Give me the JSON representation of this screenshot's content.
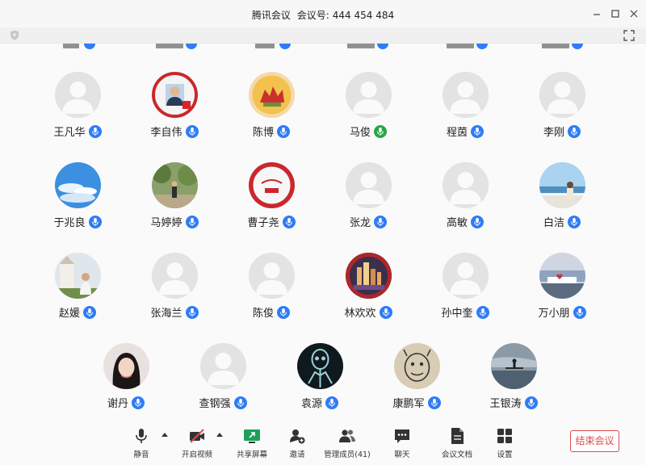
{
  "window": {
    "app_name": "腾讯会议",
    "meeting_id_label": "会议号:",
    "meeting_id": "444 454 484"
  },
  "participants": [
    {
      "name": "王凡华",
      "avatar": "default",
      "mic": "unmuted"
    },
    {
      "name": "李自伟",
      "avatar": "photo-man-red-badge",
      "mic": "unmuted"
    },
    {
      "name": "陈博",
      "avatar": "castle-emblem",
      "mic": "unmuted"
    },
    {
      "name": "马俊",
      "avatar": "default",
      "mic": "speaking"
    },
    {
      "name": "程茵",
      "avatar": "default",
      "mic": "unmuted"
    },
    {
      "name": "李刚",
      "avatar": "default",
      "mic": "unmuted"
    },
    {
      "name": "于兆良",
      "avatar": "blue-sky",
      "mic": "unmuted"
    },
    {
      "name": "马婷婷",
      "avatar": "garden-person",
      "mic": "unmuted"
    },
    {
      "name": "曹子尧",
      "avatar": "university-seal",
      "mic": "unmuted"
    },
    {
      "name": "张龙",
      "avatar": "default",
      "mic": "unmuted"
    },
    {
      "name": "高敏",
      "avatar": "default",
      "mic": "unmuted"
    },
    {
      "name": "白洁",
      "avatar": "seaside-woman",
      "mic": "unmuted"
    },
    {
      "name": "赵媛",
      "avatar": "church-woman",
      "mic": "unmuted"
    },
    {
      "name": "张海兰",
      "avatar": "default",
      "mic": "unmuted"
    },
    {
      "name": "陈俊",
      "avatar": "default",
      "mic": "unmuted"
    },
    {
      "name": "林欢欢",
      "avatar": "city-night",
      "mic": "unmuted"
    },
    {
      "name": "孙中奎",
      "avatar": "default",
      "mic": "unmuted"
    },
    {
      "name": "万小朋",
      "avatar": "heart-lake",
      "mic": "unmuted"
    },
    {
      "name": "谢丹",
      "avatar": "woman-portrait",
      "mic": "unmuted"
    },
    {
      "name": "查钢强",
      "avatar": "default",
      "mic": "unmuted"
    },
    {
      "name": "袁源",
      "avatar": "xray-skeleton",
      "mic": "unmuted"
    },
    {
      "name": "康鹏军",
      "avatar": "cartoon-face",
      "mic": "unmuted"
    },
    {
      "name": "王银涛",
      "avatar": "lake-silhouette",
      "mic": "unmuted"
    }
  ],
  "toolbar": {
    "mute": "静音",
    "video": "开启视频",
    "share": "共享屏幕",
    "invite": "邀请",
    "manage": "管理成员(41)",
    "chat": "聊天",
    "docs": "会议文档",
    "settings": "设置",
    "end": "结束会议"
  },
  "colors": {
    "accent": "#2e7cf6",
    "speaking": "#27a844",
    "end": "#e04a4a",
    "share": "#1f9f5a"
  }
}
